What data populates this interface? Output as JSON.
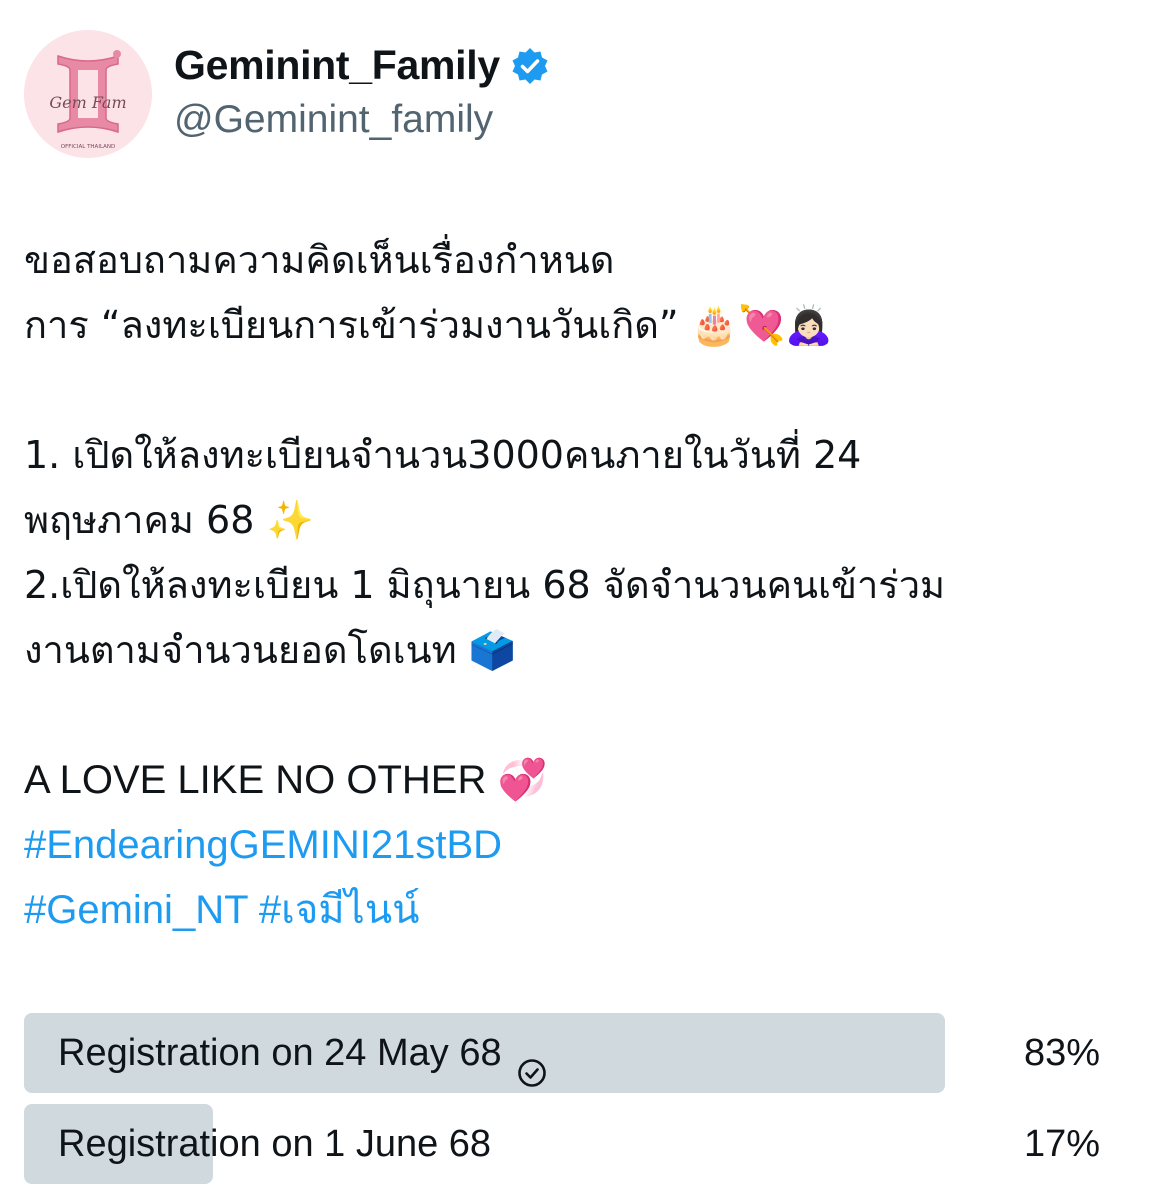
{
  "author": {
    "display_name": "Geminint_Family",
    "handle": "@Geminint_family",
    "verified": true,
    "avatar_icon": "gemfam-logo-icon",
    "avatar_bg": "#fbe3e8"
  },
  "tweet": {
    "lines": [
      "ขอสอบถามความคิดเห็นเรื่องกำหนด",
      "การ “ลงทะเบียนการเข้าร่วมงานวันเกิด” 🎂💘🙇🏻‍♀️",
      "",
      "1. เปิดให้ลงทะเบียนจำนวน3000คนภายในวันที่ 24",
      "พฤษภาคม 68 ✨",
      "2.เปิดให้ลงทะเบียน 1 มิถุนายน 68 จัดจำนวนคนเข้าร่วม",
      "งานตามจำนวนยอดโดเนท 🗳️",
      "",
      "A LOVE LIKE NO OTHER 💞"
    ],
    "hashtags_line1": "#EndearingGEMINI21stBD",
    "hashtags_line2": "#Gemini_NT #เจมีไนน์"
  },
  "poll": {
    "options": [
      {
        "label": "Registration on 24 May 68",
        "percent_text": "83%",
        "percent": 83,
        "selected": true
      },
      {
        "label": "Registration on 1 June 68",
        "percent_text": "17%",
        "percent": 17,
        "selected": false
      }
    ]
  },
  "colors": {
    "text": "#0f1419",
    "secondary": "#536471",
    "hashtag": "#1d9bf0",
    "verified": "#1d9bf0",
    "poll_bar": "#cfd9de"
  }
}
